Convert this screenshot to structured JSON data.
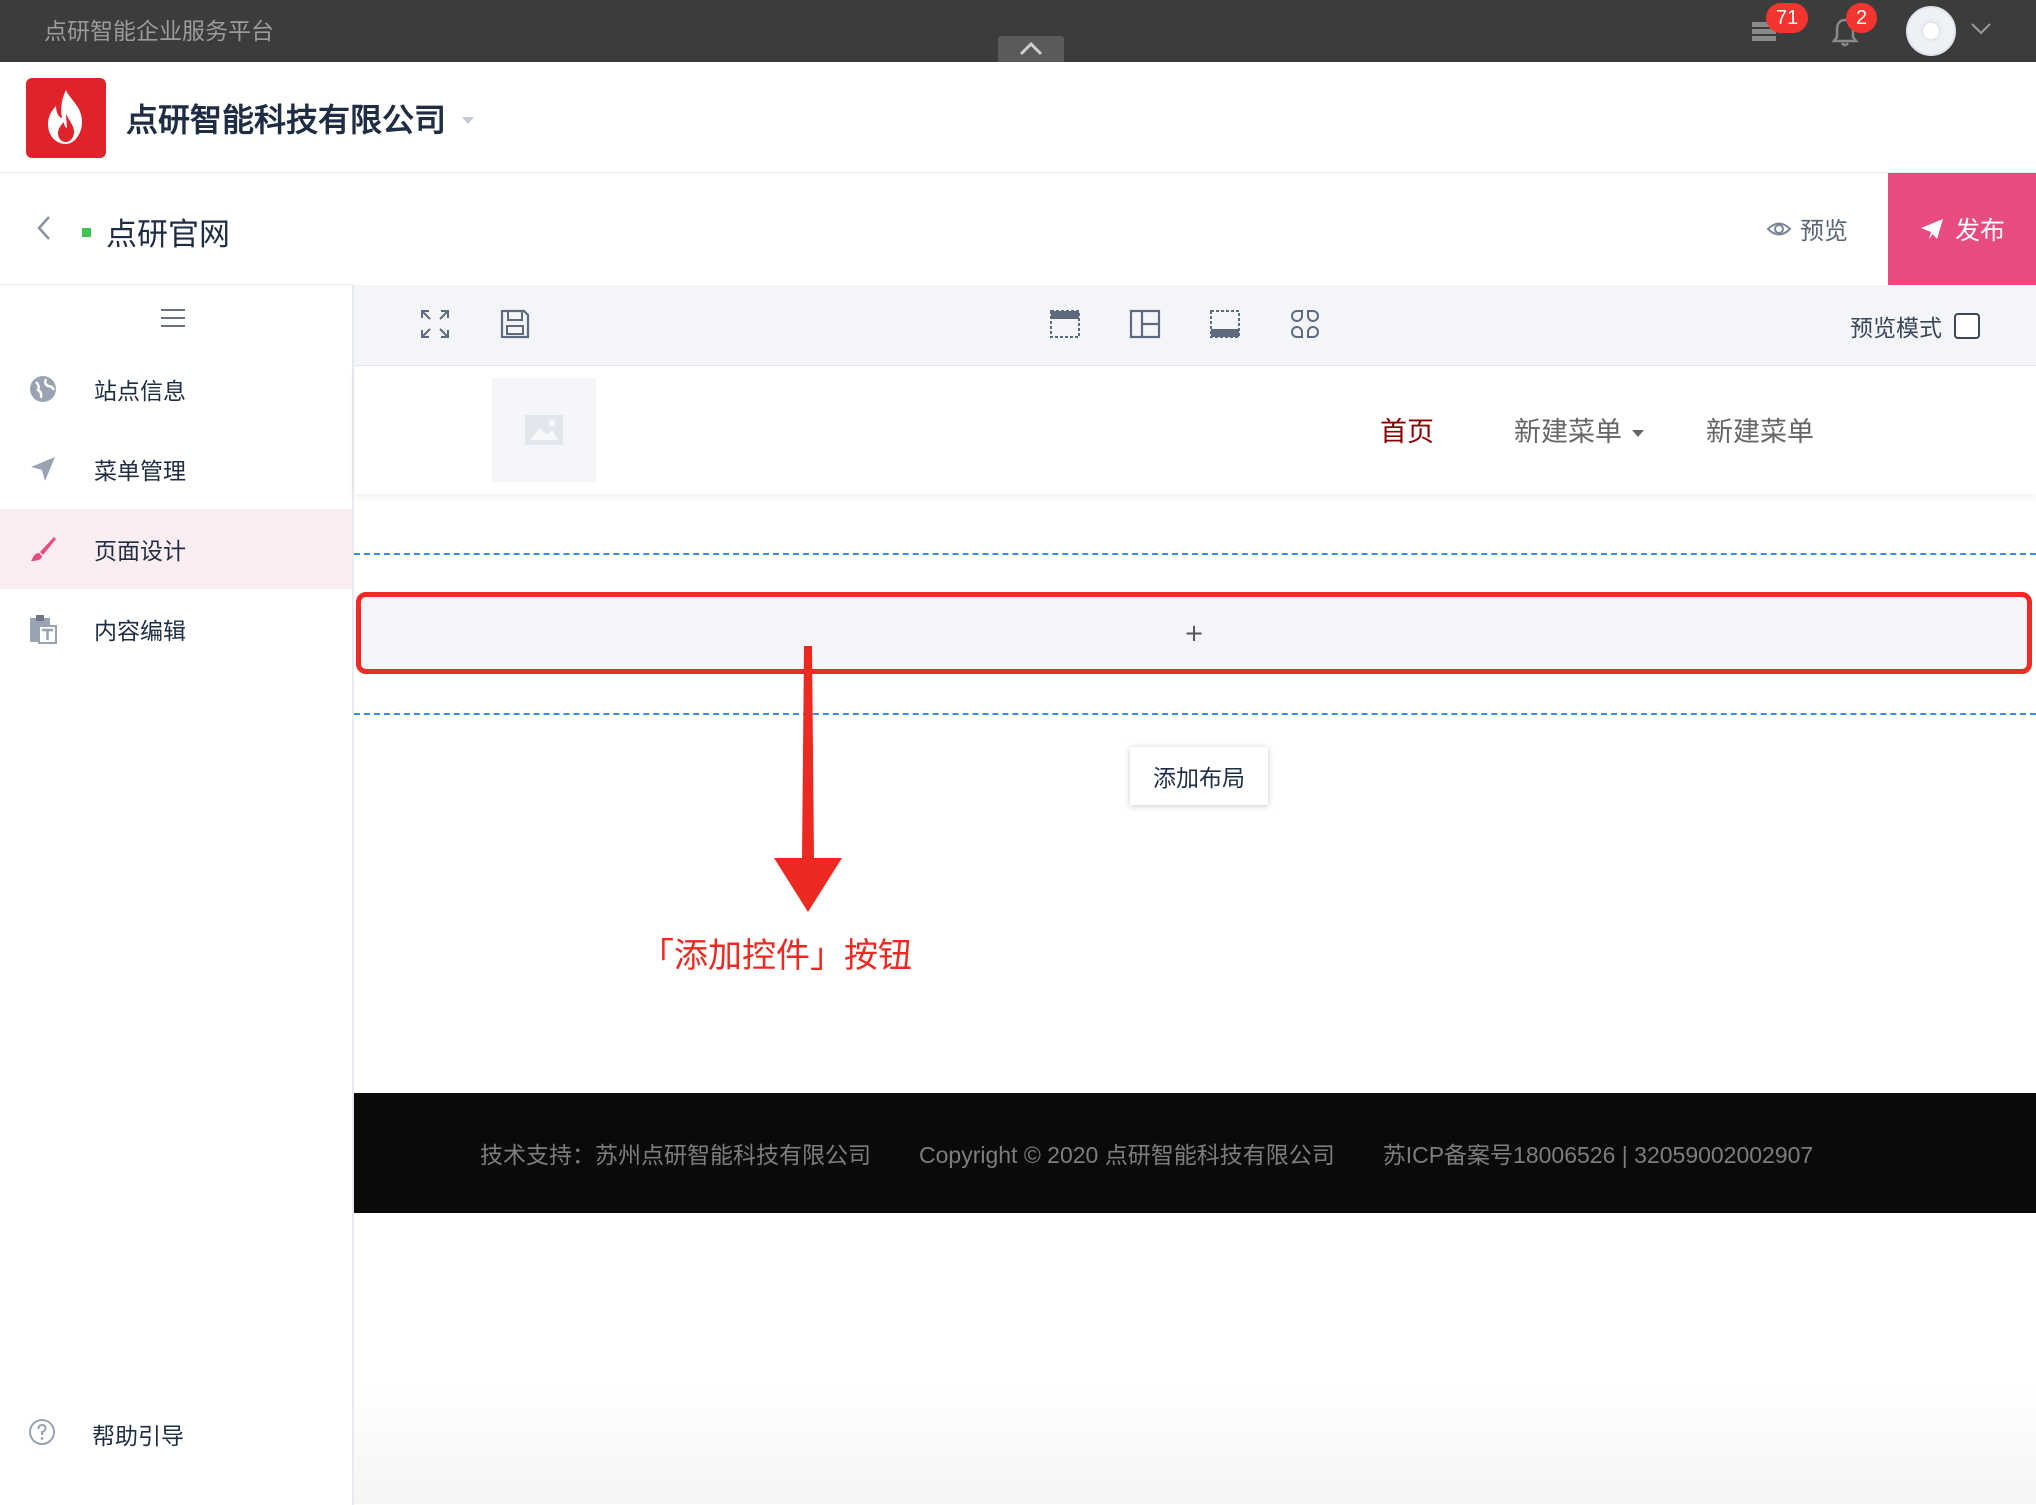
{
  "platform": {
    "title": "点研智能企业服务平台",
    "notifications": {
      "tasks_count": "71",
      "alerts_count": "2"
    }
  },
  "company": {
    "name": "点研智能科技有限公司"
  },
  "site": {
    "name": "点研官网",
    "status_color": "#3fc356",
    "preview_label": "预览",
    "publish_label": "发布",
    "publish_color": "#e84b7e"
  },
  "sidebar": {
    "items": [
      {
        "label": "站点信息",
        "icon": "globe-icon"
      },
      {
        "label": "菜单管理",
        "icon": "send-icon"
      },
      {
        "label": "页面设计",
        "icon": "brush-icon",
        "active": true
      },
      {
        "label": "内容编辑",
        "icon": "clipboard-text-icon"
      }
    ],
    "help_label": "帮助引导"
  },
  "toolbar": {
    "icons": [
      "fullscreen-icon",
      "save-icon",
      "header-layout-icon",
      "two-column-layout-icon",
      "footer-layout-icon",
      "widgets-icon"
    ],
    "preview_mode_label": "预览模式"
  },
  "site_preview": {
    "nav": {
      "home": "首页",
      "menu_1": "新建菜单",
      "menu_2": "新建菜单",
      "active_color": "#8b0000"
    },
    "add_control_symbol": "+",
    "add_layout_label": "添加布局",
    "footer": {
      "support": "技术支持：苏州点研智能科技有限公司",
      "copyright": "Copyright © 2020 点研智能科技有限公司",
      "icp": "苏ICP备案号18006526 | 32059002002907"
    }
  },
  "annotation": {
    "label": "「添加控件」按钮",
    "color": "#ec2a21"
  }
}
